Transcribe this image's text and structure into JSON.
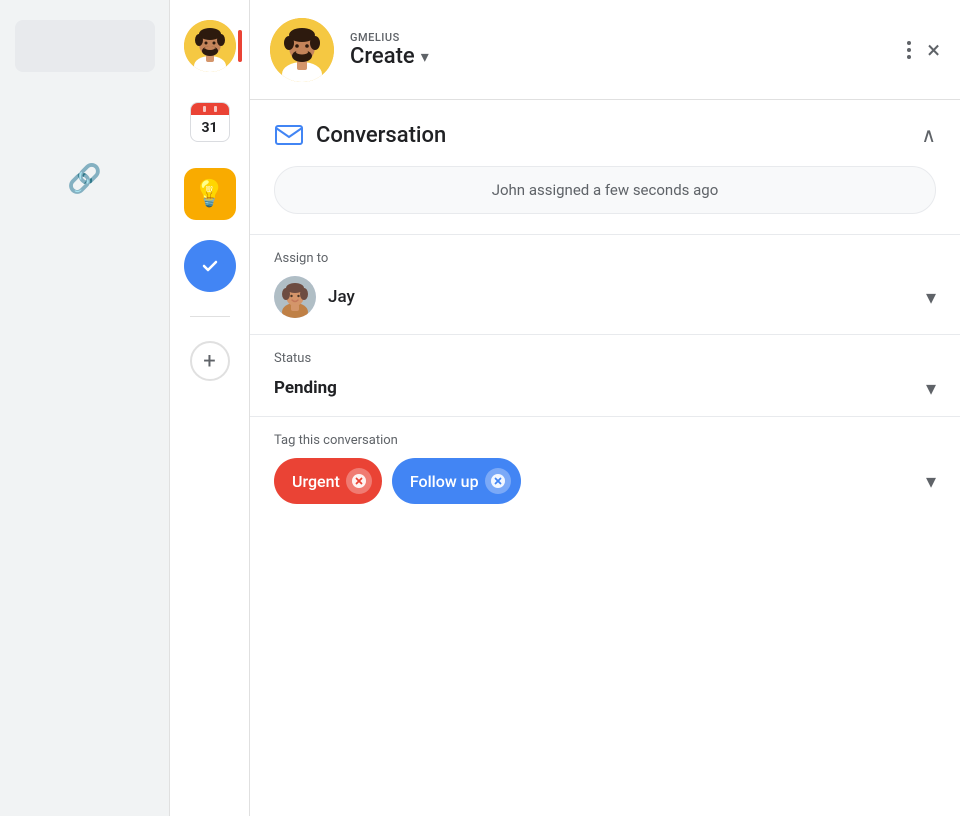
{
  "sidebar_left": {
    "link_icon": "🔗"
  },
  "sidebar_icons": {
    "gmelius_tooltip": "Gmelius",
    "calendar_label": "31",
    "plus_label": "+"
  },
  "header": {
    "gmelius_label": "GMELIUS",
    "create_label": "Create",
    "more_icon_label": "More options",
    "close_label": "×"
  },
  "conversation": {
    "section_title": "Conversation",
    "assignment_text": "John assigned a few seconds ago",
    "assign_to_label": "Assign to",
    "assignee_name": "Jay",
    "status_label": "Status",
    "status_value": "Pending",
    "tags_label": "Tag this conversation",
    "tag_urgent": "Urgent",
    "tag_followup": "Follow up"
  }
}
